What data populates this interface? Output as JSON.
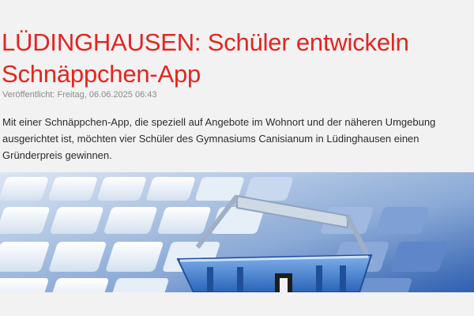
{
  "article": {
    "headline": "LÜDINGHAUSEN: Schüler entwickeln Schnäppchen-App",
    "published": "Veröffentlicht: Freitag, 06.06.2025 06:43",
    "teaser": "Mit einer Schnäppchen-App, die speziell auf Angebote im Wohnort und der näheren Umgebung ausgerichtet ist, möchten vier Schüler des Gymnasiums Canisianum in Lüdinghausen einen Gründerpreis gewinnen."
  },
  "hero_image": {
    "subject": "keyboard-with-shopping-basket"
  },
  "colors": {
    "headline": "#e3251f",
    "background": "#f2f2f2",
    "meta": "#8a8a8a",
    "body_text": "#2b2b2b"
  }
}
